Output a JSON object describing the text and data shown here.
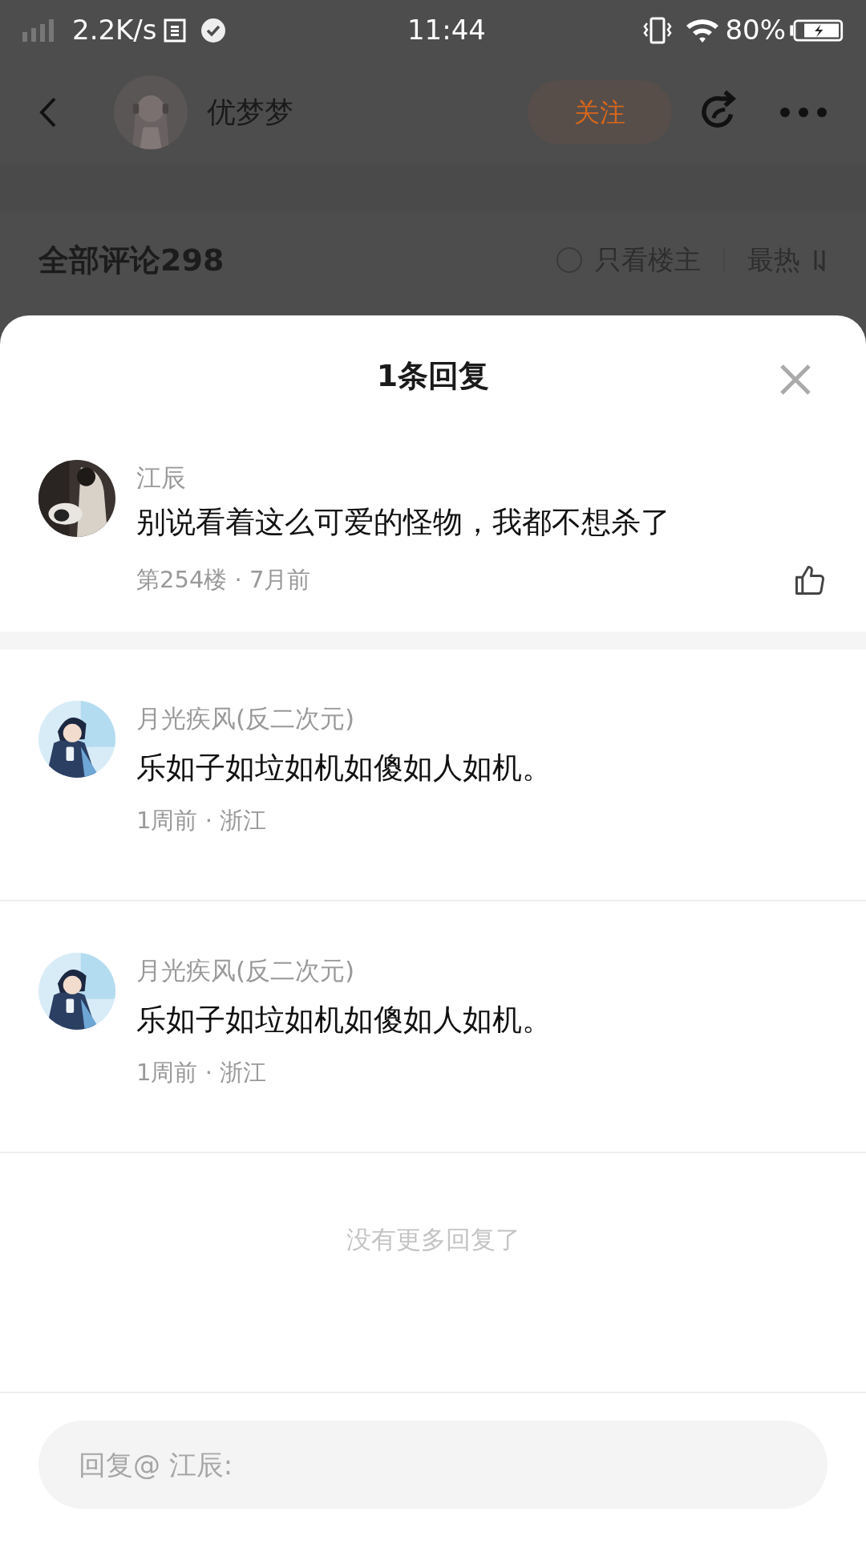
{
  "status_bar": {
    "speed": "2.2K/s",
    "time": "11:44",
    "battery": "80%"
  },
  "header": {
    "username": "优梦梦",
    "follow_button": "关注"
  },
  "comments_bar": {
    "title": "全部评论298",
    "only_op": {
      "label": "只看楼主",
      "checked": false
    },
    "sort": "最热"
  },
  "sheet": {
    "title": "1条回复",
    "main_comment": {
      "author": "江辰",
      "text": "别说看着这么可爱的怪物，我都不想杀了",
      "meta": "第254楼 · 7月前",
      "liked": false
    },
    "replies": [
      {
        "author": "月光疾风(反二次元)",
        "text": "乐如子如垃如机如傻如人如机。",
        "meta": "1周前 · 浙江"
      },
      {
        "author": "月光疾风(反二次元)",
        "text": "乐如子如垃如机如傻如人如机。",
        "meta": "1周前 · 浙江"
      }
    ],
    "end_text": "没有更多回复了",
    "reply_input": {
      "placeholder": "回复@ 江辰:"
    }
  }
}
